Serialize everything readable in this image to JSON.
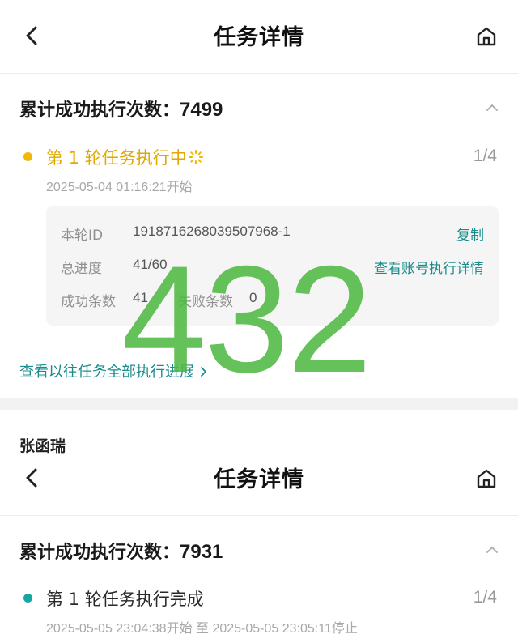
{
  "header": {
    "title": "任务详情"
  },
  "task1": {
    "total_label": "累计成功执行次数：",
    "total_value": "7499",
    "round_title": "第 1 轮任务执行中",
    "round_count": "1/4",
    "round_time": "2025-05-04 01:16:21开始",
    "status_color": "#f2b705",
    "detail": {
      "id_label": "本轮ID",
      "id_value": "1918716268039507968-1",
      "copy_label": "复制",
      "progress_label": "总进度",
      "progress_value": "41/60",
      "view_account_label": "查看账号执行详情",
      "success_label": "成功条数",
      "success_value": "41",
      "fail_label": "失败条数",
      "fail_value": "0"
    },
    "history_link": "查看以往任务全部执行进展"
  },
  "user_name": "张函瑞",
  "task2": {
    "total_label": "累计成功执行次数：",
    "total_value": "7931",
    "round_title": "第 1 轮任务执行完成",
    "round_count": "1/4",
    "round_time": "2025-05-05 23:04:38开始 至 2025-05-05 23:05:11停止",
    "status_color": "#1aa6a0"
  },
  "watermark": "432",
  "colors": {
    "accent": "#1a8c8c",
    "watermark": "#50b842"
  }
}
